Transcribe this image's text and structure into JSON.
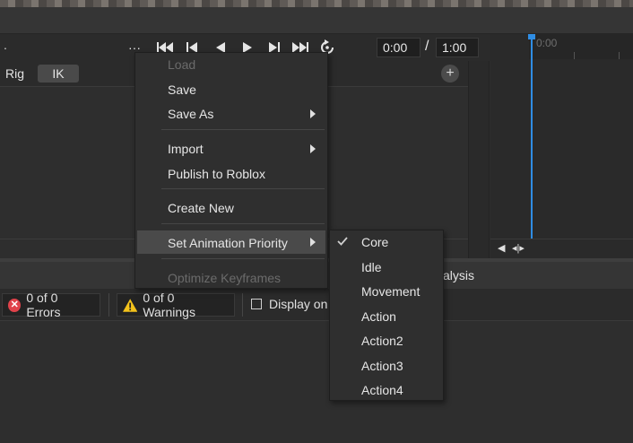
{
  "toolbar": {
    "more": "···",
    "current_time": "0:00",
    "separator": "/",
    "total_time": "1:00"
  },
  "timeline": {
    "ruler_label": "0:00"
  },
  "rig_bar": {
    "rig_label": "Rig",
    "ik_label": "IK",
    "add_label": "+"
  },
  "bottom": {
    "tab_partial": "alysis",
    "errors": "0 of 0 Errors",
    "warnings": "0 of 0 Warnings",
    "display_label": "Display on"
  },
  "menu": {
    "items": [
      {
        "label": "Load",
        "disabled": true
      },
      {
        "label": "Save"
      },
      {
        "label": "Save As",
        "submenu": true
      },
      {
        "label": "Import",
        "submenu": true
      },
      {
        "label": "Publish to Roblox"
      },
      {
        "label": "Create New"
      },
      {
        "label": "Set Animation Priority",
        "submenu": true,
        "highlighted": true
      },
      {
        "label": "Optimize Keyframes",
        "disabled": true
      }
    ]
  },
  "priority_submenu": {
    "items": [
      {
        "label": "Core",
        "checked": true
      },
      {
        "label": "Idle"
      },
      {
        "label": "Movement"
      },
      {
        "label": "Action"
      },
      {
        "label": "Action2"
      },
      {
        "label": "Action3"
      },
      {
        "label": "Action4"
      }
    ]
  },
  "colors": {
    "playhead": "#2f8de4",
    "error": "#e0424a",
    "warning": "#f3c21b"
  }
}
